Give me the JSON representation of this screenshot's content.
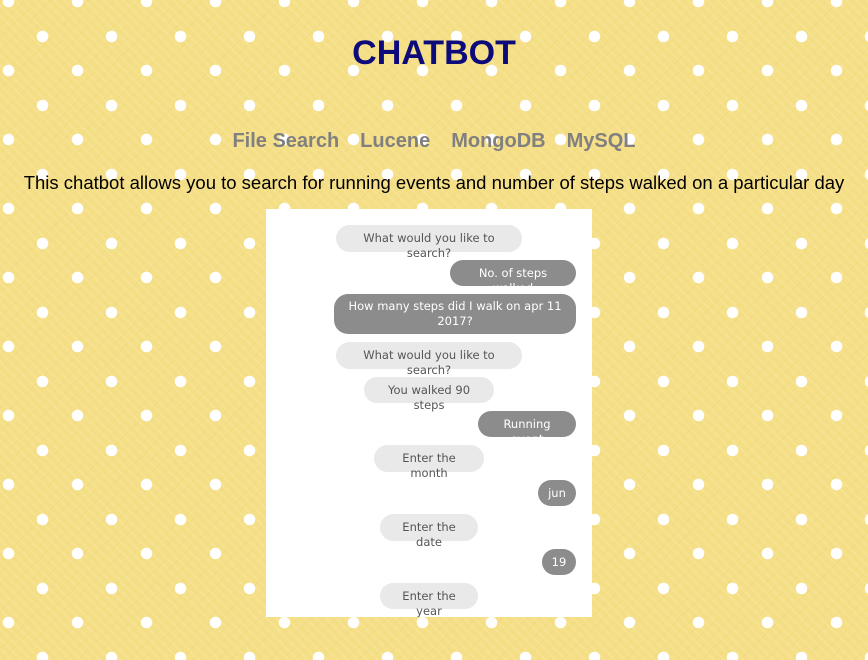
{
  "header": {
    "title": "CHATBOT"
  },
  "nav": {
    "items": [
      {
        "label": "File Search"
      },
      {
        "label": "Lucene"
      },
      {
        "label": "MongoDB"
      },
      {
        "label": "MySQL"
      }
    ]
  },
  "description": "This chatbot allows you to search for running events and number of steps walked on a particular day",
  "chat": {
    "messages": [
      {
        "sender": "bot",
        "text": "What would you like to search?"
      },
      {
        "sender": "user",
        "text": "No. of steps walked"
      },
      {
        "sender": "user",
        "text": "How many steps did I walk on apr 11 2017?"
      },
      {
        "sender": "bot",
        "text": "What would you like to search?"
      },
      {
        "sender": "bot",
        "text": "You walked 90 steps"
      },
      {
        "sender": "user",
        "text": "Running event"
      },
      {
        "sender": "bot",
        "text": "Enter the month"
      },
      {
        "sender": "user",
        "text": "jun"
      },
      {
        "sender": "bot",
        "text": "Enter the date"
      },
      {
        "sender": "user",
        "text": "19"
      },
      {
        "sender": "bot",
        "text": "Enter the year"
      }
    ]
  },
  "colors": {
    "background": "#f5df86",
    "title": "#0d0b7a",
    "nav_link": "#808080",
    "bot_bubble": "#e9e9e9",
    "user_bubble": "#8c8c8c"
  }
}
